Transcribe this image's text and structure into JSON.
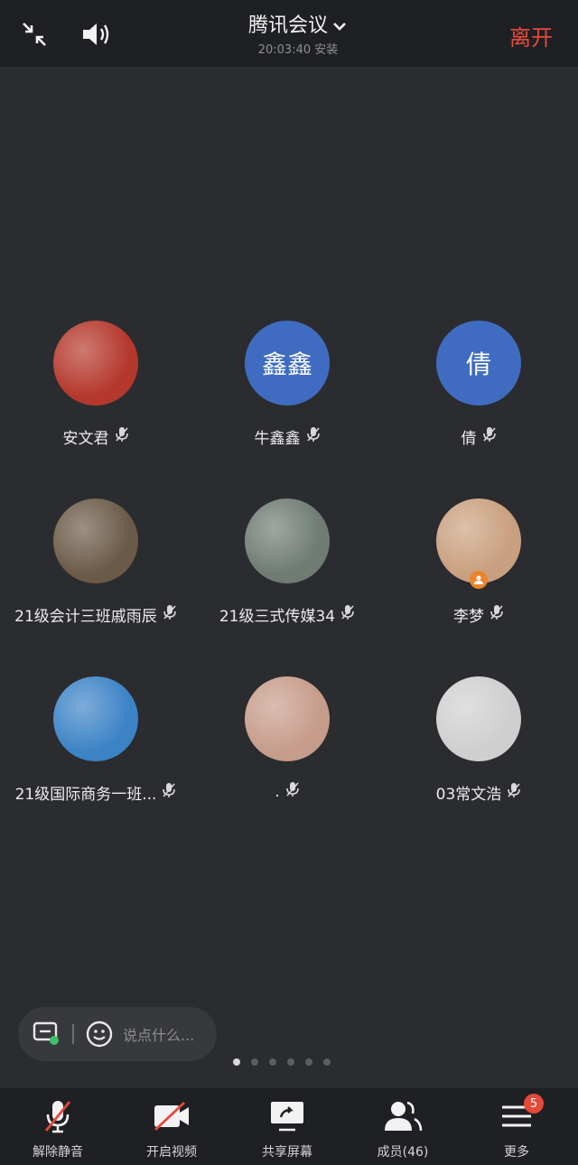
{
  "header": {
    "title": "腾讯会议",
    "subtitle": "20:03:40 安装",
    "leave_label": "离开"
  },
  "participants": [
    {
      "name": "安文君",
      "avatar_text": "",
      "avatar_color": "#b5382c"
    },
    {
      "name": "牛鑫鑫",
      "avatar_text": "鑫鑫",
      "avatar_color": "#3f6cc0"
    },
    {
      "name": "倩",
      "avatar_text": "倩",
      "avatar_color": "#3f6cc0"
    },
    {
      "name": "21级会计三班戚雨辰",
      "avatar_text": "",
      "avatar_color": "#6b5a47"
    },
    {
      "name": "21级三式传媒34",
      "avatar_text": "",
      "avatar_color": "#6f7b73"
    },
    {
      "name": "李梦",
      "avatar_text": "",
      "avatar_color": "#c9a07f"
    },
    {
      "name": "21级国际商务一班...",
      "avatar_text": "",
      "avatar_color": "#3c83c6"
    },
    {
      "name": ".",
      "avatar_text": "",
      "avatar_color": "#c69c8a"
    },
    {
      "name": "03常文浩",
      "avatar_text": "",
      "avatar_color": "#cfcfcf"
    }
  ],
  "chat": {
    "placeholder": "说点什么..."
  },
  "pager": {
    "count": 6,
    "active": 1
  },
  "toolbar": {
    "mute_label": "解除静音",
    "video_label": "开启视频",
    "share_label": "共享屏幕",
    "members_label": "成员(46)",
    "more_label": "更多",
    "more_badge": "5"
  },
  "colors": {
    "accent_red": "#e5493a",
    "avatar_blue": "#3f6cc0",
    "background": "#2b2c30",
    "bar": "#1f2023"
  }
}
